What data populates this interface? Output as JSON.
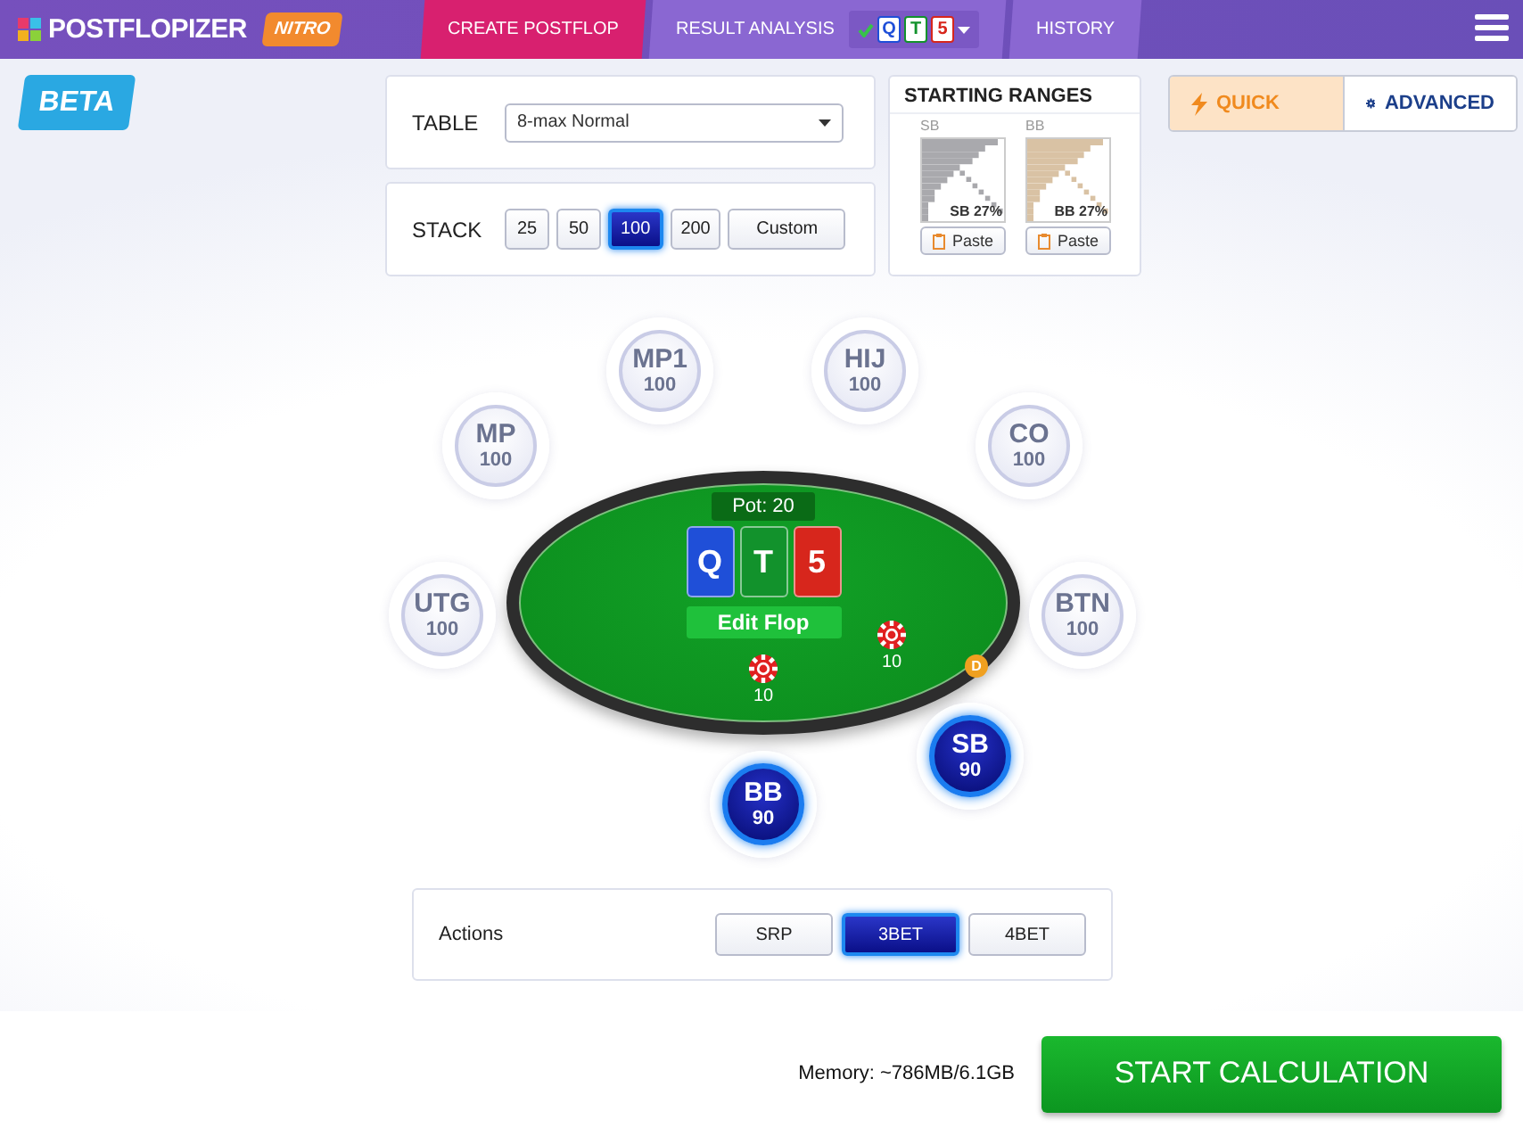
{
  "app": {
    "logo": "POSTFLOPIZER",
    "edition": "NITRO"
  },
  "nav_tabs": [
    {
      "label": "CREATE POSTFLOP",
      "selected": true
    },
    {
      "label": "RESULT ANALYSIS",
      "selected": false,
      "board": [
        {
          "rank": "Q",
          "color": "#1f4fd8"
        },
        {
          "rank": "T",
          "color": "#12922c"
        },
        {
          "rank": "5",
          "color": "#d7261c"
        }
      ]
    },
    {
      "label": "HISTORY",
      "selected": false
    }
  ],
  "beta_badge": "BETA",
  "table_setting": {
    "label": "TABLE",
    "value": "8-max Normal"
  },
  "stack_setting": {
    "label": "STACK",
    "options": [
      {
        "label": "25",
        "selected": false
      },
      {
        "label": "50",
        "selected": false
      },
      {
        "label": "100",
        "selected": true
      },
      {
        "label": "200",
        "selected": false
      },
      {
        "label": "Custom",
        "selected": false
      }
    ]
  },
  "starting_ranges": {
    "title": "STARTING RANGES",
    "ranges": [
      {
        "position": "SB",
        "caption": "SB 27%",
        "color": "#a9a9ad",
        "button": "Paste"
      },
      {
        "position": "BB",
        "caption": "BB 27%",
        "color": "#d9c2a4",
        "button": "Paste"
      }
    ]
  },
  "modes": [
    {
      "label": "QUICK",
      "kind": "bolt",
      "selected": true
    },
    {
      "label": "ADVANCED",
      "kind": "gear",
      "selected": false
    }
  ],
  "seats": [
    {
      "name": "MP1",
      "stack": "100",
      "selected": false
    },
    {
      "name": "HIJ",
      "stack": "100",
      "selected": false
    },
    {
      "name": "MP",
      "stack": "100",
      "selected": false
    },
    {
      "name": "CO",
      "stack": "100",
      "selected": false
    },
    {
      "name": "UTG",
      "stack": "100",
      "selected": false
    },
    {
      "name": "BTN",
      "stack": "100",
      "selected": false
    },
    {
      "name": "SB",
      "stack": "90",
      "selected": true
    },
    {
      "name": "BB",
      "stack": "90",
      "selected": true
    }
  ],
  "pot": "Pot: 20",
  "board": [
    {
      "rank": "Q",
      "color": "#1f4fd8"
    },
    {
      "rank": "T",
      "color": "#12922c"
    },
    {
      "rank": "5",
      "color": "#d7261c"
    }
  ],
  "edit_flop_button": "Edit Flop",
  "dealer_button": "D",
  "bets": [
    {
      "amount": "10"
    },
    {
      "amount": "10"
    }
  ],
  "actions": {
    "label": "Actions",
    "options": [
      {
        "label": "SRP",
        "selected": false
      },
      {
        "label": "3BET",
        "selected": true
      },
      {
        "label": "4BET",
        "selected": false
      }
    ]
  },
  "memory": "Memory: ~786MB/6.1GB",
  "start_button": "START CALCULATION"
}
